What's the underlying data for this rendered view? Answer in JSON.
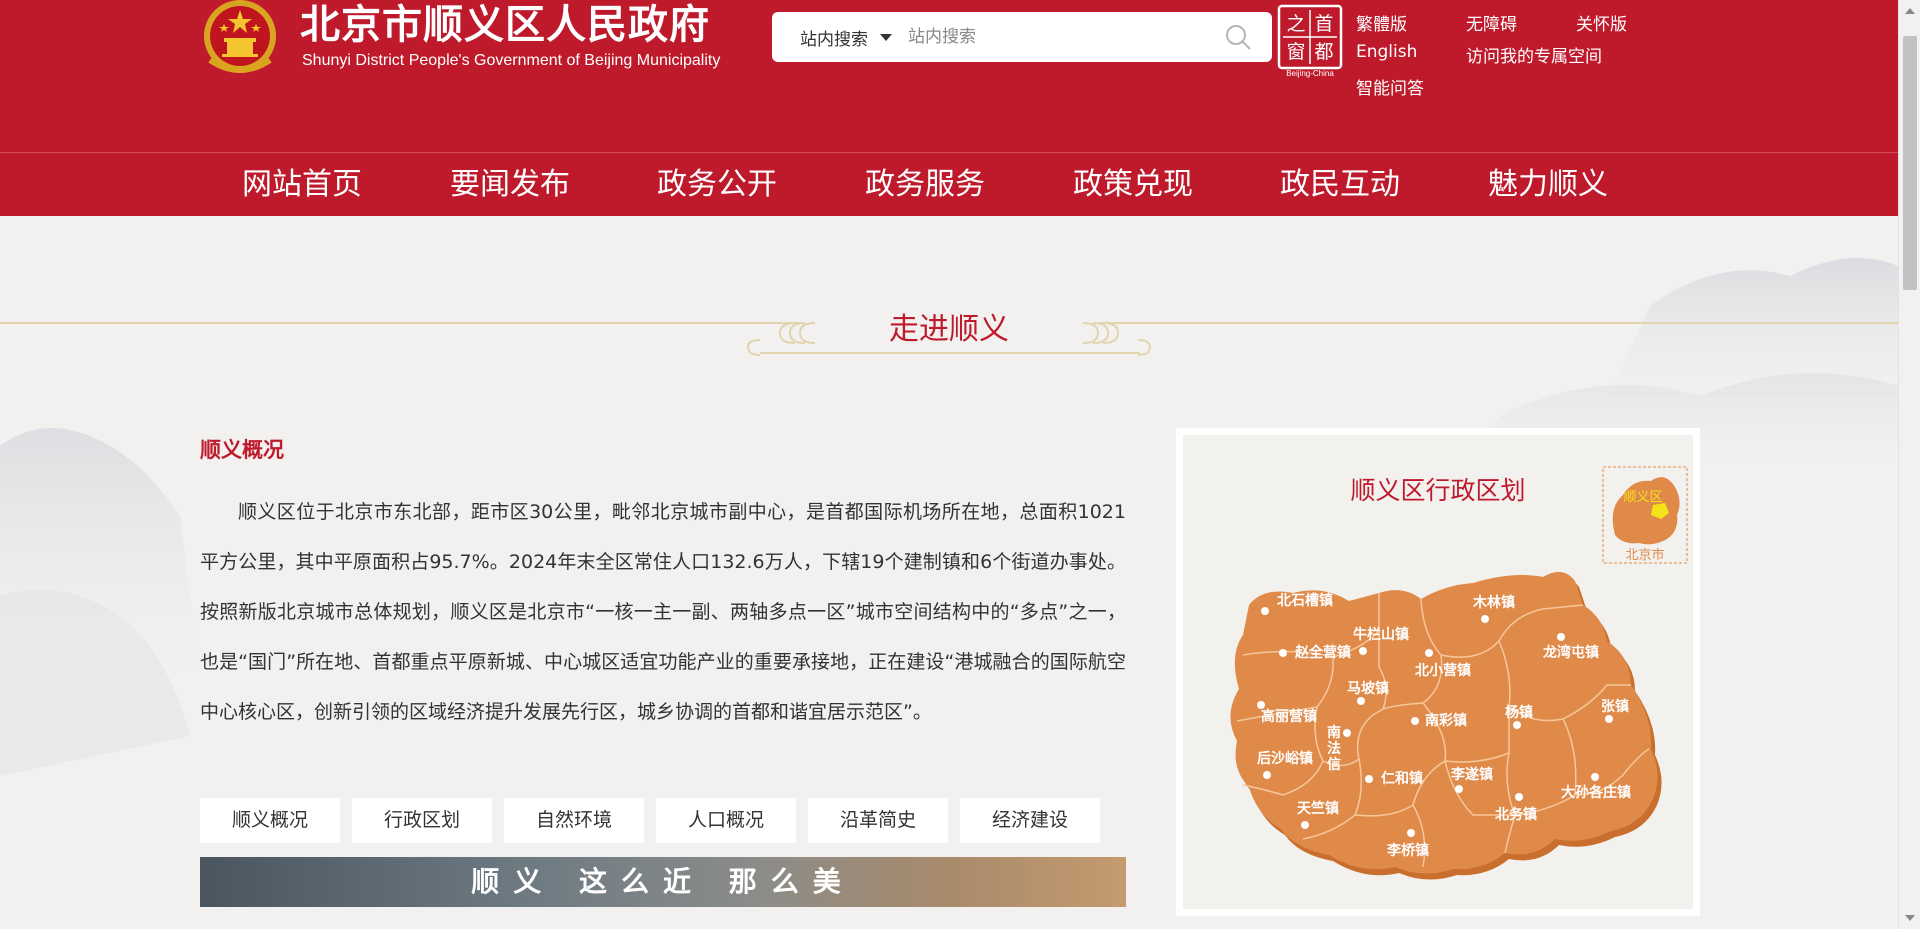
{
  "header": {
    "site_name": "北京市顺义区人民政府",
    "site_name_en": "Shunyi District People's Government of Beijing Municipality",
    "search": {
      "scope_label": "站内搜索",
      "placeholder": "站内搜索"
    },
    "capital_logo": {
      "chars": [
        "首",
        "都",
        "之",
        "窗"
      ],
      "caption": "Beijing-China"
    },
    "top_links": [
      "繁體版",
      "无障碍",
      "关怀版",
      "English",
      "访问我的专属空间",
      "智能问答"
    ]
  },
  "nav": {
    "items": [
      "网站首页",
      "要闻发布",
      "政务公开",
      "政务服务",
      "政策兑现",
      "政民互动",
      "魅力顺义"
    ]
  },
  "section": {
    "title": "走进顺义"
  },
  "intro": {
    "heading": "顺义概况",
    "text": "顺义区位于北京市东北部，距市区30公里，毗邻北京城市副中心，是首都国际机场所在地，总面积1021平方公里，其中平原面积占95.7%。2024年末全区常住人口132.6万人，下辖19个建制镇和6个街道办事处。按照新版北京城市总体规划，顺义区是北京市“一核一主一副、两轴多点一区”城市空间结构中的“多点”之一，也是“国门”所在地、首都重点平原新城、中心城区适宜功能产业的重要承接地，正在建设“港城融合的国际航空中心核心区，创新引领的区域经济提升发展先行区，城乡协调的首都和谐宜居示范区”。",
    "tabs": [
      "顺义概况",
      "行政区划",
      "自然环境",
      "人口概况",
      "沿革简史",
      "经济建设"
    ],
    "banner_text": "顺义 这么近 那么美"
  },
  "map": {
    "title": "顺义区行政区划",
    "inset_label_district": "顺义区",
    "inset_label_city": "北京市",
    "towns": [
      "北石槽镇",
      "赵全营镇",
      "牛栏山镇",
      "木林镇",
      "龙湾屯镇",
      "北小营镇",
      "高丽营镇",
      "马坡镇",
      "南彩镇",
      "杨镇",
      "张镇",
      "后沙峪镇",
      "南法信镇",
      "仁和镇",
      "李遂镇",
      "天竺镇",
      "李桥镇",
      "北务镇",
      "大孙各庄镇"
    ],
    "colors": {
      "land": "#e08a49",
      "land_dark": "#c96e2c",
      "boundary": "#f6c79a"
    }
  },
  "colors": {
    "brand_red": "#be1a2c",
    "page_bg": "#f2f1f0"
  }
}
